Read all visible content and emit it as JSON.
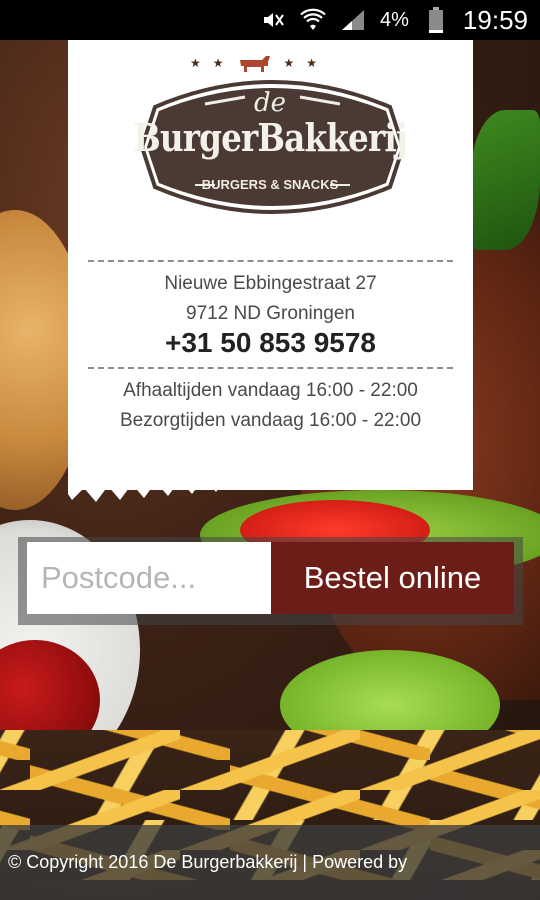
{
  "status_bar": {
    "icons": [
      "mute-icon",
      "wifi-icon",
      "signal-icon",
      "battery-icon"
    ],
    "battery_percent": "4%",
    "time": "19:59"
  },
  "logo": {
    "prefix": "de",
    "name": "BurgerBakkerij",
    "tagline": "BURGERS & SNACKS",
    "colors": {
      "badge": "#4a3a33",
      "text": "#f4f0ea"
    }
  },
  "info": {
    "street": "Nieuwe Ebbingestraat 27",
    "city": "9712 ND Groningen",
    "phone": "+31 50 853 9578",
    "pickup": "Afhaaltijden vandaag 16:00 - 22:00",
    "delivery": "Bezorgtijden vandaag 16:00 - 22:00"
  },
  "order": {
    "postcode_placeholder": "Postcode...",
    "postcode_value": "",
    "button_label": "Bestel online",
    "button_color": "#6d1d18"
  },
  "footer": {
    "text": "© Copyright 2016 De Burgerbakkerij | Powered by"
  }
}
